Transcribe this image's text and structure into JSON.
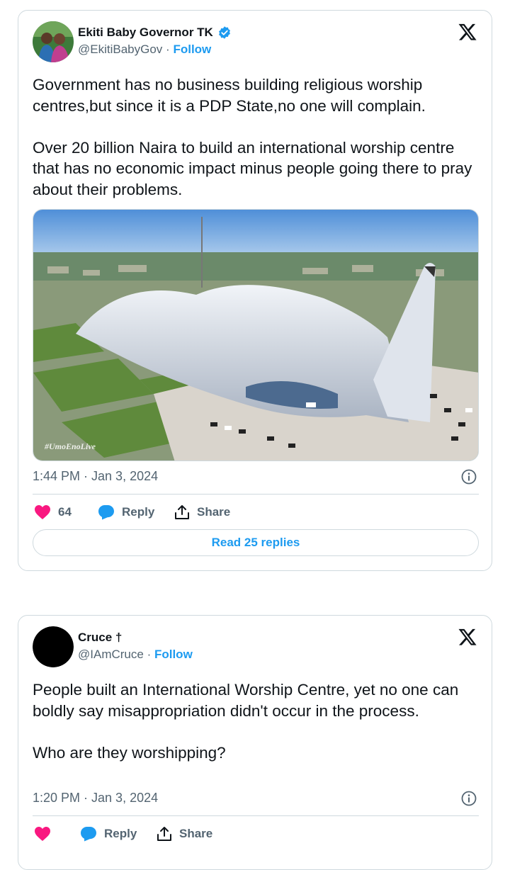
{
  "tweets": [
    {
      "author_name": "Ekiti Baby Governor TK",
      "verified": true,
      "handle": "@EkitiBabyGov",
      "separator": "·",
      "follow_label": "Follow",
      "paragraphs": [
        "Government has no business building religious worship centres,but since it is a PDP State,no one will complain.",
        "Over 20 billion Naira to build an international worship centre that has no economic impact minus people going there to pray about their problems."
      ],
      "image_watermark": "#UmoEnoLive",
      "timestamp": "1:44 PM · Jan 3, 2024",
      "like_count": "64",
      "reply_label": "Reply",
      "share_label": "Share",
      "read_replies_label": "Read 25 replies"
    },
    {
      "author_name": "Cruce †",
      "verified": false,
      "handle": "@IAmCruce",
      "separator": "·",
      "follow_label": "Follow",
      "paragraphs": [
        "People built an International Worship Centre, yet no one can boldly say misappropriation didn't occur in the process.",
        "Who are they worshipping?"
      ],
      "timestamp": "1:20 PM · Jan 3, 2024",
      "like_count": "",
      "reply_label": "Reply",
      "share_label": "Share"
    }
  ],
  "colors": {
    "like": "#f91880",
    "reply": "#1d9bf0",
    "link": "#1d9bf0",
    "muted": "#536471",
    "border": "#cfd9de"
  },
  "icons": [
    "verified-badge-icon",
    "x-logo-icon",
    "info-icon",
    "heart-icon",
    "reply-bubble-icon",
    "share-icon"
  ]
}
